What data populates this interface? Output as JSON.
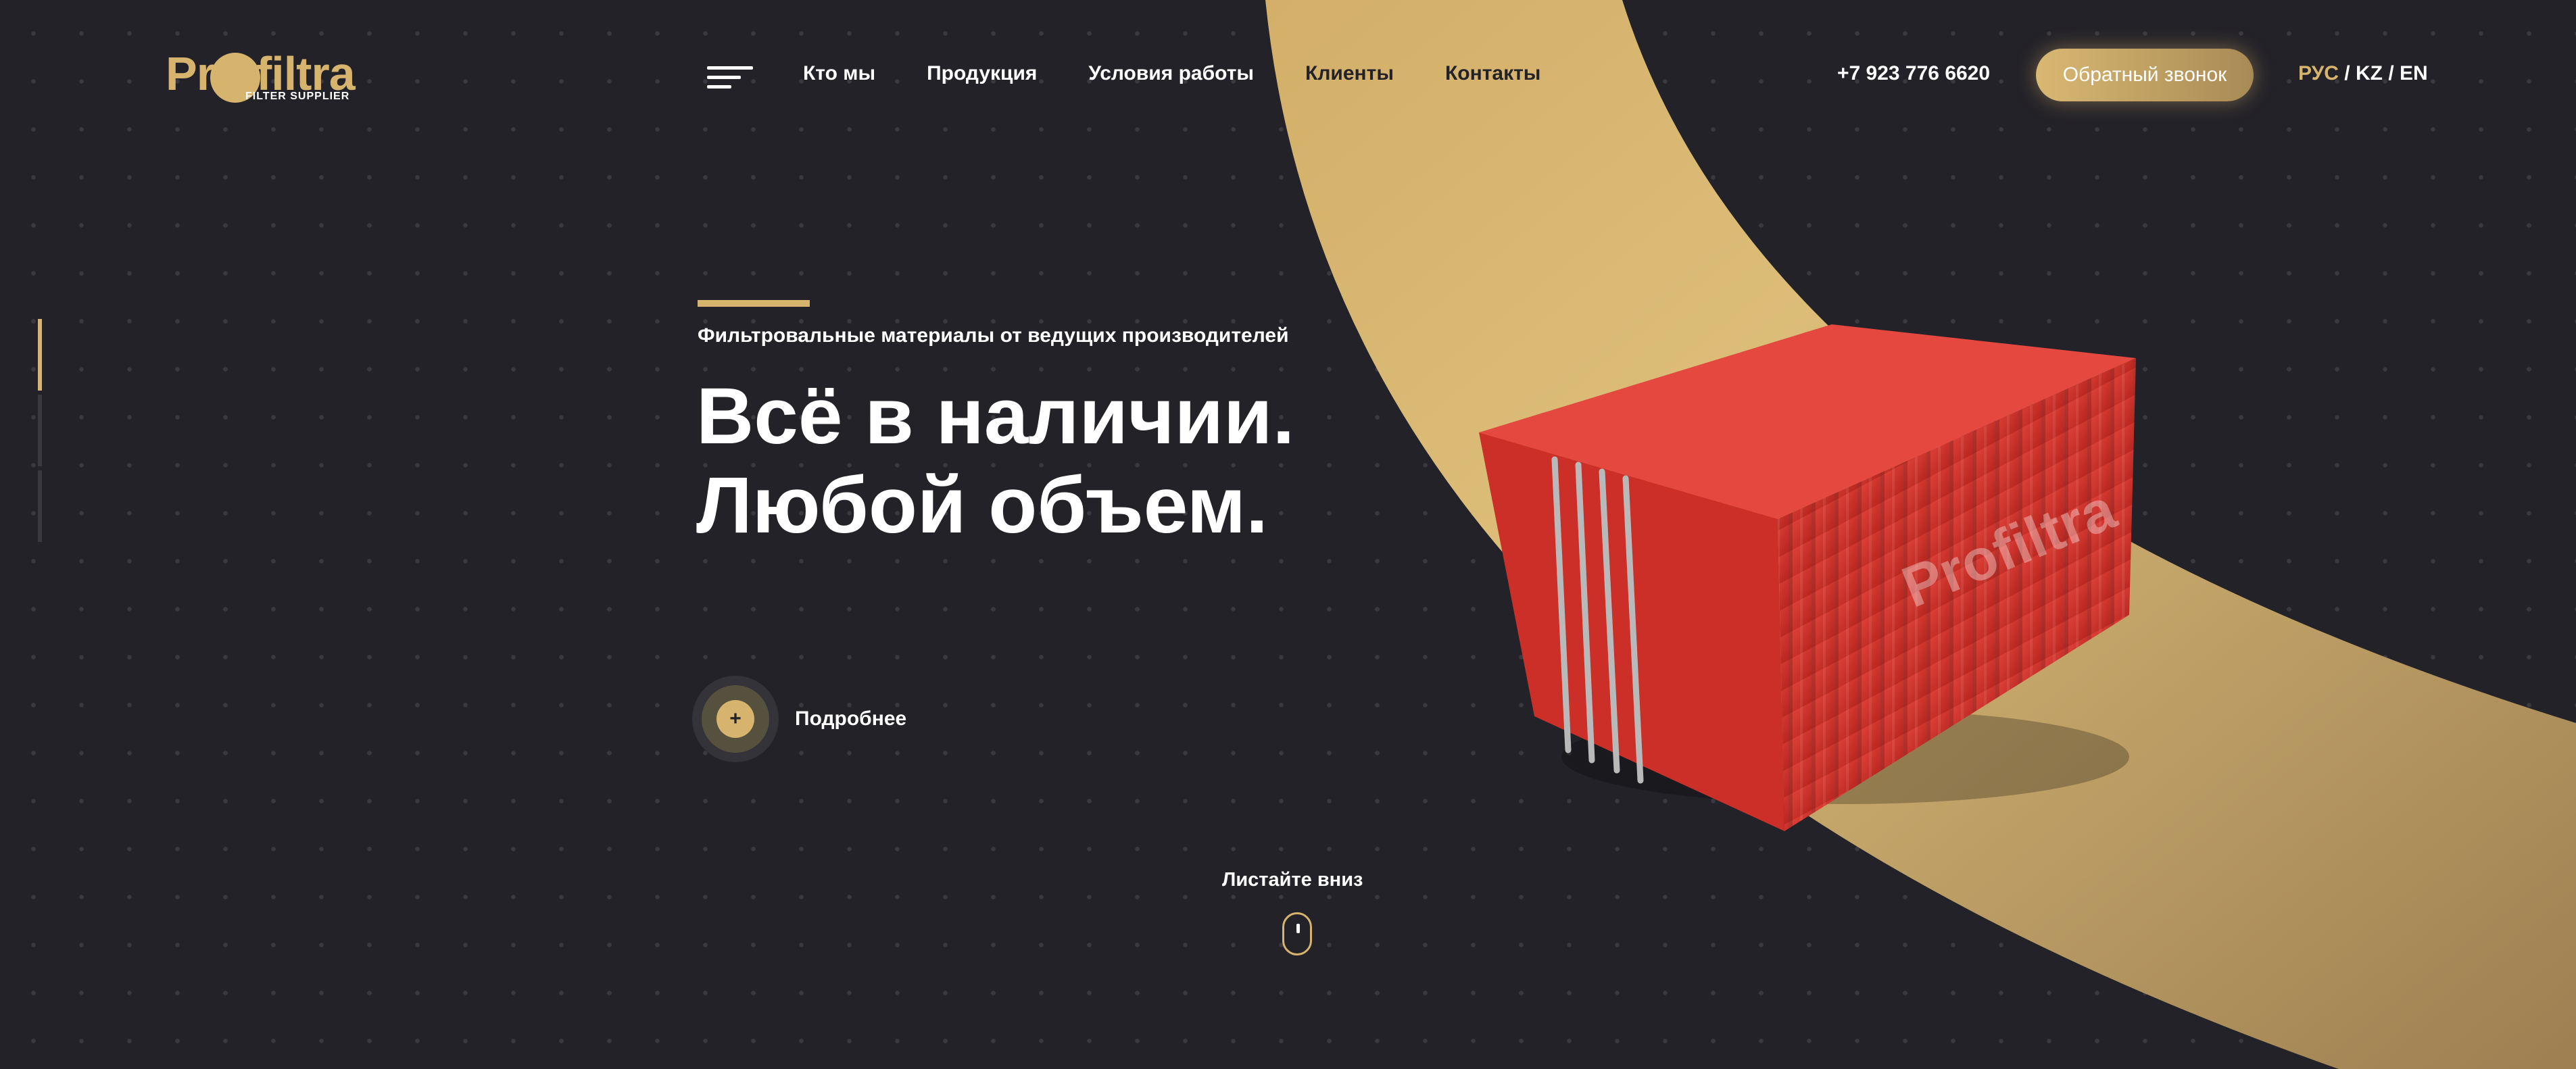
{
  "colors": {
    "background": "#232228",
    "accent": "#d6b46e",
    "container": "#d8352f"
  },
  "logo": {
    "word_pre": "Pr",
    "word_post": "filtra",
    "subtitle": "FILTER SUPPLIER"
  },
  "nav": {
    "menu_icon": "hamburger-icon",
    "items": [
      {
        "label": "Кто мы"
      },
      {
        "label": "Продукция"
      },
      {
        "label": "Условия работы"
      },
      {
        "label": "Клиенты"
      },
      {
        "label": "Контакты"
      }
    ]
  },
  "header": {
    "phone": "+7 923 776 6620",
    "callback_label": "Обратный звонок",
    "lang": {
      "active": "РУС",
      "sep": "/",
      "kz": "KZ",
      "en": "EN"
    }
  },
  "hero": {
    "subtitle": "Фильтровальные материалы от ведущих производителей",
    "heading_line1": "Всё в наличии.",
    "heading_line2": "Любой объем.",
    "more_label": "Подробнее",
    "more_icon": "plus-icon",
    "container_text": "Profiltra"
  },
  "scroll": {
    "label": "Листайте вниз",
    "icon": "mouse-icon"
  },
  "slides": {
    "count": 3,
    "active": 1
  }
}
